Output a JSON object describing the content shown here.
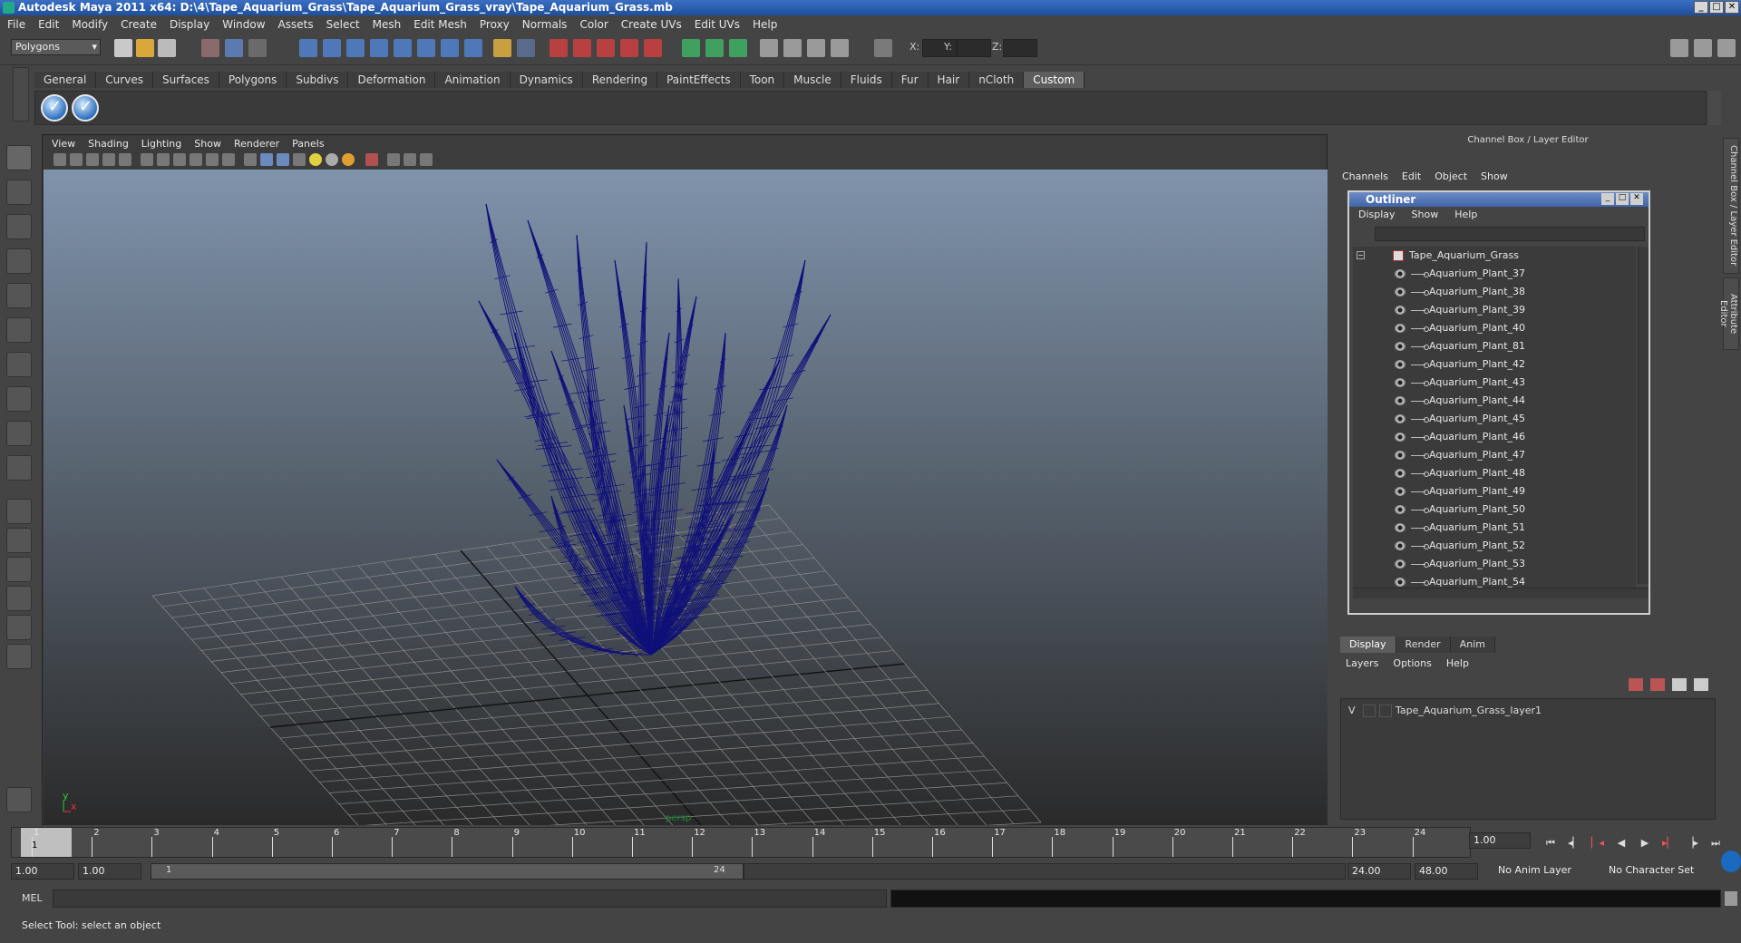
{
  "window": {
    "title": "Autodesk Maya 2011 x64: D:\\4\\Tape_Aquarium_Grass\\Tape_Aquarium_Grass_vray\\Tape_Aquarium_Grass.mb",
    "minimize": "_",
    "maximize": "□",
    "close": "✕"
  },
  "menubar": [
    "File",
    "Edit",
    "Modify",
    "Create",
    "Display",
    "Window",
    "Assets",
    "Select",
    "Mesh",
    "Edit Mesh",
    "Proxy",
    "Normals",
    "Color",
    "Create UVs",
    "Edit UVs",
    "Help"
  ],
  "statusline": {
    "mode": "Polygons",
    "x_label": "X:",
    "y_label": "Y:",
    "z_label": "Z:"
  },
  "shelf": {
    "tabs": [
      "General",
      "Curves",
      "Surfaces",
      "Polygons",
      "Subdivs",
      "Deformation",
      "Animation",
      "Dynamics",
      "Rendering",
      "PaintEffects",
      "Toon",
      "Muscle",
      "Fluids",
      "Fur",
      "Hair",
      "nCloth",
      "Custom"
    ],
    "active_tab": "Custom"
  },
  "viewport": {
    "menu": [
      "View",
      "Shading",
      "Lighting",
      "Show",
      "Renderer",
      "Panels"
    ],
    "camera_label": "persp",
    "axis_x": "x",
    "axis_y": "y"
  },
  "channel_box": {
    "title": "Channel Box / Layer Editor",
    "menu": [
      "Channels",
      "Edit",
      "Object",
      "Show"
    ],
    "side_tab_1": "Channel Box / Layer Editor",
    "side_tab_2": "Attribute Editor"
  },
  "outliner": {
    "title": "Outliner",
    "menu": [
      "Display",
      "Show",
      "Help"
    ],
    "root": "Tape_Aquarium_Grass",
    "items": [
      "Aquarium_Plant_37",
      "Aquarium_Plant_38",
      "Aquarium_Plant_39",
      "Aquarium_Plant_40",
      "Aquarium_Plant_81",
      "Aquarium_Plant_42",
      "Aquarium_Plant_43",
      "Aquarium_Plant_44",
      "Aquarium_Plant_45",
      "Aquarium_Plant_46",
      "Aquarium_Plant_47",
      "Aquarium_Plant_48",
      "Aquarium_Plant_49",
      "Aquarium_Plant_50",
      "Aquarium_Plant_51",
      "Aquarium_Plant_52",
      "Aquarium_Plant_53",
      "Aquarium_Plant_54"
    ]
  },
  "layer_editor": {
    "tabs": [
      "Display",
      "Render",
      "Anim"
    ],
    "active_tab": "Display",
    "menu": [
      "Layers",
      "Options",
      "Help"
    ],
    "layer_visibility": "V",
    "layer_name": "Tape_Aquarium_Grass_layer1"
  },
  "timeline": {
    "ticks": [
      "1",
      "2",
      "3",
      "4",
      "5",
      "6",
      "7",
      "8",
      "9",
      "10",
      "11",
      "12",
      "13",
      "14",
      "15",
      "16",
      "17",
      "18",
      "19",
      "20",
      "21",
      "22",
      "23",
      "24"
    ],
    "current_frame": "1.00",
    "playhead_label": "1"
  },
  "range": {
    "start": "1.00",
    "playback_start": "1.00",
    "range_start_label": "1",
    "range_end_label": "24",
    "playback_end": "24.00",
    "end": "48.00",
    "anim_layer": "No Anim Layer",
    "character_set": "No Character Set"
  },
  "command_line": {
    "label": "MEL"
  },
  "help_line": {
    "text": "Select Tool: select an object"
  },
  "colors": {
    "wireframe": "#10107a",
    "grid": "#8a8a8a",
    "viewport_top": "#7f93ab",
    "viewport_bottom": "#2a2a2a",
    "title_bar": "#2a5fb0"
  }
}
